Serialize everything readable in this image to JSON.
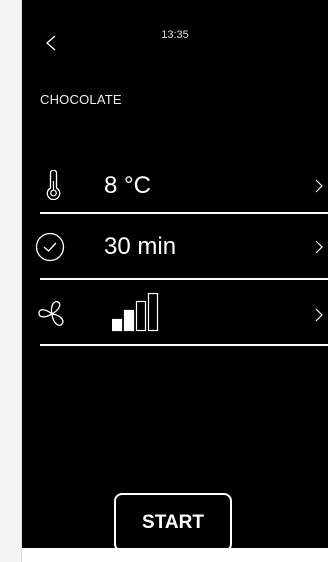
{
  "status_bar": {
    "time": "13:35"
  },
  "header": {
    "back_icon": "chevron-left-icon",
    "title": "CHOCOLATE"
  },
  "settings": [
    {
      "id": "temperature",
      "icon": "thermometer-icon",
      "value": "8 °C"
    },
    {
      "id": "time",
      "icon": "clock-icon",
      "value": "30 min"
    },
    {
      "id": "fan",
      "icon": "fan-icon",
      "fan_level": 2,
      "fan_levels_total": 4
    }
  ],
  "footer": {
    "start_label": "START"
  },
  "colors": {
    "background": "#000000",
    "foreground": "#ffffff",
    "frame": "#f3f3f3"
  }
}
